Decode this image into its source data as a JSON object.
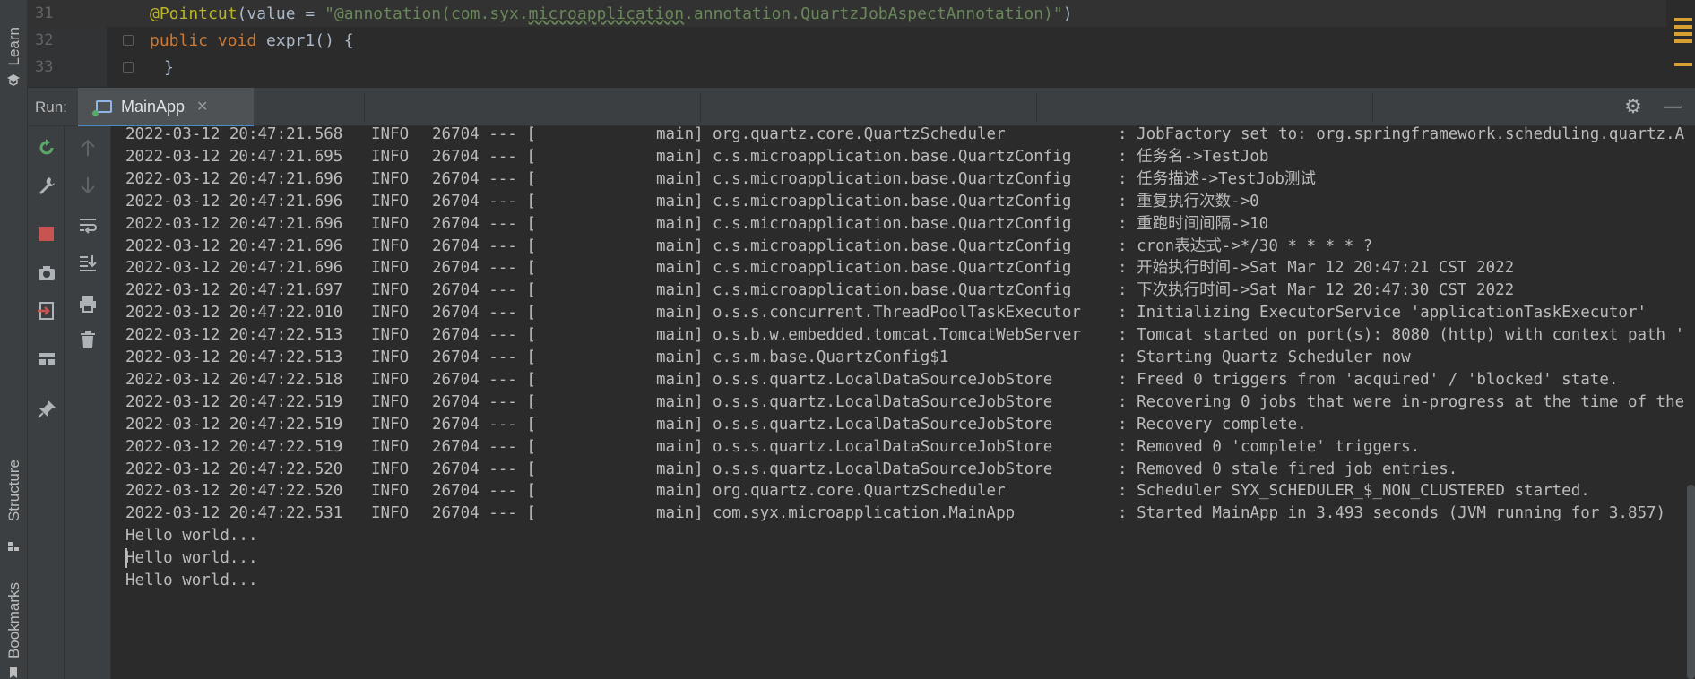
{
  "editor": {
    "lines": [
      {
        "number": "31",
        "parts": [
          {
            "text": "@Pointcut",
            "cls": "ann"
          },
          {
            "text": "(value = ",
            "cls": "fn"
          },
          {
            "text": "\"@annotation(com.syx.",
            "cls": "str"
          },
          {
            "text": "microapplication",
            "cls": "str squig"
          },
          {
            "text": ".annotation.QuartzJobAspectAnnotation)\"",
            "cls": "str"
          },
          {
            "text": ")",
            "cls": "fn"
          }
        ]
      },
      {
        "number": "32",
        "parts": [
          {
            "text": "public void ",
            "cls": "kw"
          },
          {
            "text": "expr1",
            "cls": "fn"
          },
          {
            "text": "() {",
            "cls": "fn"
          }
        ]
      },
      {
        "number": "33",
        "parts": [
          {
            "text": "}",
            "cls": "fn"
          }
        ]
      }
    ]
  },
  "left_strip": {
    "tabs": [
      {
        "label": "Learn",
        "icon": "learn-icon"
      },
      {
        "label": "Structure",
        "icon": "structure-icon"
      },
      {
        "label": "Bookmarks",
        "icon": "bookmark-icon"
      }
    ]
  },
  "run": {
    "label": "Run:",
    "tab_label": "MainApp",
    "close_glyph": "✕",
    "settings_icon": "gear-icon",
    "minimize_icon": "minimize-icon"
  },
  "colors": {
    "annotation": "#bbb529",
    "keyword": "#cc7832",
    "string": "#6a8759",
    "console_text": "#bbbbbb",
    "rerun_green": "#59a869",
    "stop_red": "#c75450",
    "tab_accent": "#4a88c7"
  },
  "console": {
    "logs": [
      {
        "date": "2022-03-12 20:47:21.568",
        "level": "INFO",
        "pid": "26704 --- [",
        "thread": "main]",
        "logger": "org.quartz.core.QuartzScheduler",
        "msg": ": JobFactory set to: org.springframework.scheduling.quartz.A"
      },
      {
        "date": "2022-03-12 20:47:21.695",
        "level": "INFO",
        "pid": "26704 --- [",
        "thread": "main]",
        "logger": "c.s.microapplication.base.QuartzConfig",
        "msg": ": 任务名->TestJob"
      },
      {
        "date": "2022-03-12 20:47:21.696",
        "level": "INFO",
        "pid": "26704 --- [",
        "thread": "main]",
        "logger": "c.s.microapplication.base.QuartzConfig",
        "msg": ": 任务描述->TestJob测试"
      },
      {
        "date": "2022-03-12 20:47:21.696",
        "level": "INFO",
        "pid": "26704 --- [",
        "thread": "main]",
        "logger": "c.s.microapplication.base.QuartzConfig",
        "msg": ": 重复执行次数->0"
      },
      {
        "date": "2022-03-12 20:47:21.696",
        "level": "INFO",
        "pid": "26704 --- [",
        "thread": "main]",
        "logger": "c.s.microapplication.base.QuartzConfig",
        "msg": ": 重跑时间间隔->10"
      },
      {
        "date": "2022-03-12 20:47:21.696",
        "level": "INFO",
        "pid": "26704 --- [",
        "thread": "main]",
        "logger": "c.s.microapplication.base.QuartzConfig",
        "msg": ": cron表达式->*/30 * * * * ?"
      },
      {
        "date": "2022-03-12 20:47:21.696",
        "level": "INFO",
        "pid": "26704 --- [",
        "thread": "main]",
        "logger": "c.s.microapplication.base.QuartzConfig",
        "msg": ": 开始执行时间->Sat Mar 12 20:47:21 CST 2022"
      },
      {
        "date": "2022-03-12 20:47:21.697",
        "level": "INFO",
        "pid": "26704 --- [",
        "thread": "main]",
        "logger": "c.s.microapplication.base.QuartzConfig",
        "msg": ": 下次执行时间->Sat Mar 12 20:47:30 CST 2022"
      },
      {
        "date": "2022-03-12 20:47:22.010",
        "level": "INFO",
        "pid": "26704 --- [",
        "thread": "main]",
        "logger": "o.s.s.concurrent.ThreadPoolTaskExecutor",
        "msg": ": Initializing ExecutorService 'applicationTaskExecutor'"
      },
      {
        "date": "2022-03-12 20:47:22.513",
        "level": "INFO",
        "pid": "26704 --- [",
        "thread": "main]",
        "logger": "o.s.b.w.embedded.tomcat.TomcatWebServer",
        "msg": ": Tomcat started on port(s): 8080 (http) with context path '"
      },
      {
        "date": "2022-03-12 20:47:22.513",
        "level": "INFO",
        "pid": "26704 --- [",
        "thread": "main]",
        "logger": "c.s.m.base.QuartzConfig$1",
        "msg": ": Starting Quartz Scheduler now"
      },
      {
        "date": "2022-03-12 20:47:22.518",
        "level": "INFO",
        "pid": "26704 --- [",
        "thread": "main]",
        "logger": "o.s.s.quartz.LocalDataSourceJobStore",
        "msg": ": Freed 0 triggers from 'acquired' / 'blocked' state."
      },
      {
        "date": "2022-03-12 20:47:22.519",
        "level": "INFO",
        "pid": "26704 --- [",
        "thread": "main]",
        "logger": "o.s.s.quartz.LocalDataSourceJobStore",
        "msg": ": Recovering 0 jobs that were in-progress at the time of the"
      },
      {
        "date": "2022-03-12 20:47:22.519",
        "level": "INFO",
        "pid": "26704 --- [",
        "thread": "main]",
        "logger": "o.s.s.quartz.LocalDataSourceJobStore",
        "msg": ": Recovery complete."
      },
      {
        "date": "2022-03-12 20:47:22.519",
        "level": "INFO",
        "pid": "26704 --- [",
        "thread": "main]",
        "logger": "o.s.s.quartz.LocalDataSourceJobStore",
        "msg": ": Removed 0 'complete' triggers."
      },
      {
        "date": "2022-03-12 20:47:22.520",
        "level": "INFO",
        "pid": "26704 --- [",
        "thread": "main]",
        "logger": "o.s.s.quartz.LocalDataSourceJobStore",
        "msg": ": Removed 0 stale fired job entries."
      },
      {
        "date": "2022-03-12 20:47:22.520",
        "level": "INFO",
        "pid": "26704 --- [",
        "thread": "main]",
        "logger": "org.quartz.core.QuartzScheduler",
        "msg": ": Scheduler SYX_SCHEDULER_$_NON_CLUSTERED started."
      },
      {
        "date": "2022-03-12 20:47:22.531",
        "level": "INFO",
        "pid": "26704 --- [",
        "thread": "main]",
        "logger": "com.syx.microapplication.MainApp",
        "msg": ": Started MainApp in 3.493 seconds (JVM running for 3.857)"
      }
    ],
    "plain_lines": [
      "Hello world...",
      "Hello world...",
      "Hello world..."
    ]
  }
}
